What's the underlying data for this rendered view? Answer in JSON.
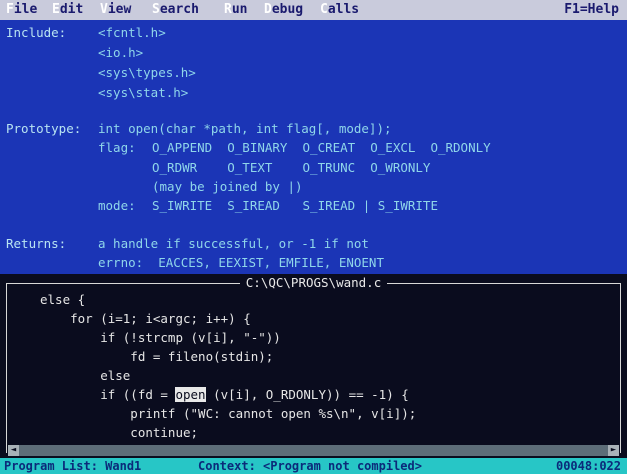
{
  "menu": {
    "items": [
      {
        "hot": "F",
        "rest": "ile"
      },
      {
        "hot": "E",
        "rest": "dit"
      },
      {
        "hot": "V",
        "rest": "iew"
      },
      {
        "hot": "S",
        "rest": "earch"
      },
      {
        "hot": "R",
        "rest": "un"
      },
      {
        "hot": "D",
        "rest": "ebug"
      },
      {
        "hot": "C",
        "rest": "alls"
      }
    ],
    "help": "F1=Help"
  },
  "help_panel": {
    "include_label": "Include:",
    "includes": [
      "<fcntl.h>",
      "<io.h>",
      "<sys\\types.h>",
      "<sys\\stat.h>"
    ],
    "prototype_label": "Prototype:",
    "prototype": "int open(char *path, int flag[, mode]);",
    "flag_label": "flag:",
    "flag_line1": "O_APPEND  O_BINARY  O_CREAT  O_EXCL  O_RDONLY",
    "flag_line2": "O_RDWR    O_TEXT    O_TRUNC  O_WRONLY",
    "flag_note": "(may be joined by |)",
    "mode_label": "mode:",
    "mode_line": "S_IWRITE  S_IREAD   S_IREAD | S_IWRITE",
    "returns_label": "Returns:",
    "returns_line": "a handle if successful, or -1 if not",
    "errno_line": "errno:  EACCES, EEXIST, EMFILE, ENOENT"
  },
  "editor": {
    "filename": "C:\\QC\\PROGS\\wand.c",
    "lines": [
      "else {",
      "    for (i=1; i<argc; i++) {",
      "        if (!strcmp (v[i], \"-\"))",
      "            fd = fileno(stdin);",
      "        else",
      "            printf (\"WC: cannot open %s\\n\", v[i]);",
      "            continue;"
    ],
    "sel_line_pre": "        if ((fd = ",
    "sel_word": "open",
    "sel_line_post": " (v[i], O_RDONLY)) == -1) {"
  },
  "status": {
    "program_list": "Program List: Wand1",
    "context": "Context: <Program not compiled>",
    "position": "00048:022"
  }
}
